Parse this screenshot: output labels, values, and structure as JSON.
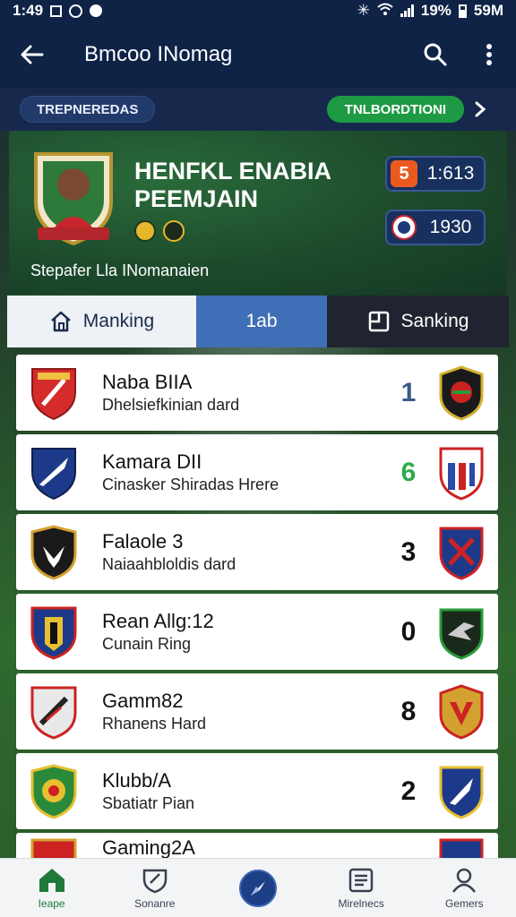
{
  "status_bar": {
    "time": "1:49",
    "battery_pct": "19%",
    "right_text": "59M"
  },
  "app_bar": {
    "title": "Bmcoo INomag"
  },
  "chips": {
    "left": "TREPNEREDAS",
    "right": "TNLBORDTIONI"
  },
  "hero": {
    "title_line1": "HENFKL ENABIA",
    "title_line2": "PEEMJAIN",
    "subtitle": "Stepafer Lla INomanaien",
    "score_a": "1:613",
    "score_a_icon": "5",
    "score_b": "1930"
  },
  "tabs": [
    {
      "label": "Manking",
      "icon": "home-icon"
    },
    {
      "label": "1ab",
      "icon": ""
    },
    {
      "label": "Sanking",
      "icon": "document-icon"
    }
  ],
  "rows": [
    {
      "title": "Naba BIIA",
      "sub": "Dhelsiefkinian dard",
      "num": "1",
      "num_color": "#3a5a8a"
    },
    {
      "title": "Kamara DII",
      "sub": "Cinasker Shiradas Hrere",
      "num": "6",
      "num_color": "#2eaa4a"
    },
    {
      "title": "Falaole 3",
      "sub": "Naiaahbloldis dard",
      "num": "3",
      "num_color": "#111111"
    },
    {
      "title": "Rean Allg:12",
      "sub": "Cunain Ring",
      "num": "0",
      "num_color": "#111111"
    },
    {
      "title": "Gamm82",
      "sub": "Rhanens Hard",
      "num": "8",
      "num_color": "#111111"
    },
    {
      "title": "Klubb/A",
      "sub": "Sbatiatr Pian",
      "num": "2",
      "num_color": "#111111"
    },
    {
      "title": "Gaming2A",
      "sub": "",
      "num": "",
      "num_color": "#111111"
    }
  ],
  "bottom_nav": [
    {
      "label": "Ieape",
      "icon": "home-icon"
    },
    {
      "label": "Sonanre",
      "icon": "shield-icon"
    },
    {
      "label": "",
      "icon": "compass-icon"
    },
    {
      "label": "Mirelnecs",
      "icon": "list-icon"
    },
    {
      "label": "Gemers",
      "icon": "user-icon"
    }
  ],
  "colors": {
    "app_bar": "#0f2347",
    "accent_green": "#1f9a44",
    "tab_active": "#3f6fb6"
  }
}
